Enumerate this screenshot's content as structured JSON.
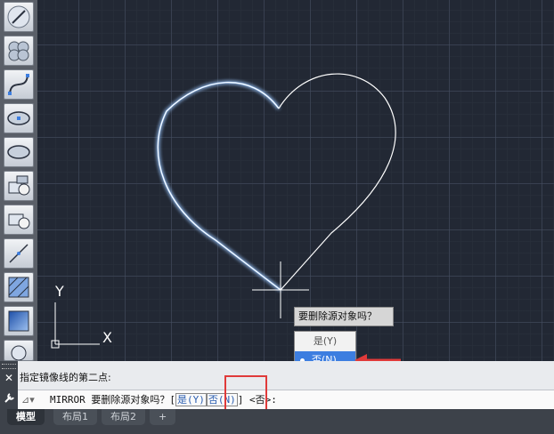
{
  "toolbar": {
    "tools": [
      {
        "name": "line-tool-icon"
      },
      {
        "name": "revision-cloud-icon"
      },
      {
        "name": "spline-icon"
      },
      {
        "name": "ellipse-center-icon"
      },
      {
        "name": "ellipse-icon"
      },
      {
        "name": "insert-block-icon"
      },
      {
        "name": "make-block-icon"
      },
      {
        "name": "point-icon"
      },
      {
        "name": "hatch-icon"
      },
      {
        "name": "gradient-icon"
      },
      {
        "name": "region-icon"
      }
    ]
  },
  "ucs": {
    "x_label": "X",
    "y_label": "Y"
  },
  "dynamic_prompt": {
    "question": "要删除源对象吗？",
    "options": [
      {
        "label": "是(Y)",
        "selected": false
      },
      {
        "label": "否(N)",
        "selected": true
      }
    ]
  },
  "command": {
    "history": "指定镜像线的第二点:",
    "prefix": "MIRROR 要删除源对象吗？",
    "bracket_open": "[",
    "opt_yes": "是(Y)",
    "opt_no": "否(N)",
    "bracket_close": "]",
    "suffix": "<否>:"
  },
  "tabs": [
    {
      "label": "模型",
      "active": true
    },
    {
      "label": "布局1",
      "active": false
    },
    {
      "label": "布局2",
      "active": false
    },
    {
      "label": "+",
      "active": false
    }
  ],
  "colors": {
    "annotation": "#e03a3a",
    "highlight": "#3d7ee0",
    "glow": "#4fa0ff"
  }
}
